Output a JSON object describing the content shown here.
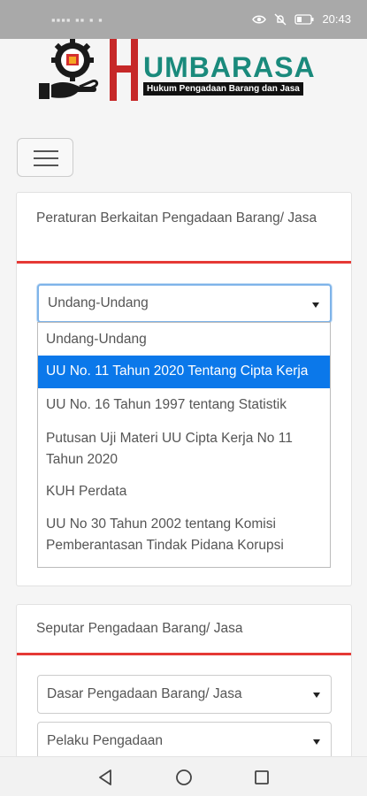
{
  "status_bar": {
    "left_indicators": "▪▪▪▪ ▪▪ ▪ ▪",
    "time": "20:43"
  },
  "brand": {
    "logo_letter": "H",
    "name": "UMBARASA",
    "tagline": "Hukum Pengadaan Barang dan Jasa"
  },
  "nav": {
    "menu_icon": "hamburger-icon"
  },
  "section1": {
    "title": "Peraturan Berkaitan Pengadaan Barang/ Jasa",
    "select_value": "Undang-Undang",
    "options": [
      {
        "label": "Undang-Undang"
      },
      {
        "label": "UU No. 11 Tahun 2020 Tentang Cipta Kerja",
        "selected": true
      },
      {
        "label": "UU No. 16 Tahun 1997 tentang Statistik"
      },
      {
        "label": "Putusan Uji Materi UU Cipta Kerja No 11 Tahun 2020"
      },
      {
        "label": "KUH Perdata"
      },
      {
        "label": "UU No 30 Tahun 2002 tentang Komisi Pemberantasan Tindak Pidana Korupsi"
      }
    ]
  },
  "section2": {
    "title": "Seputar Pengadaan Barang/ Jasa",
    "select1_value": "Dasar Pengadaan Barang/ Jasa",
    "select2_value": "Pelaku Pengadaan"
  },
  "system_nav": {
    "back": "back-icon",
    "home": "home-icon",
    "recents": "recents-icon"
  },
  "colors": {
    "accent_red": "#e53935",
    "highlight_blue": "#0b78ea",
    "brand_teal": "#1a8a7c"
  }
}
